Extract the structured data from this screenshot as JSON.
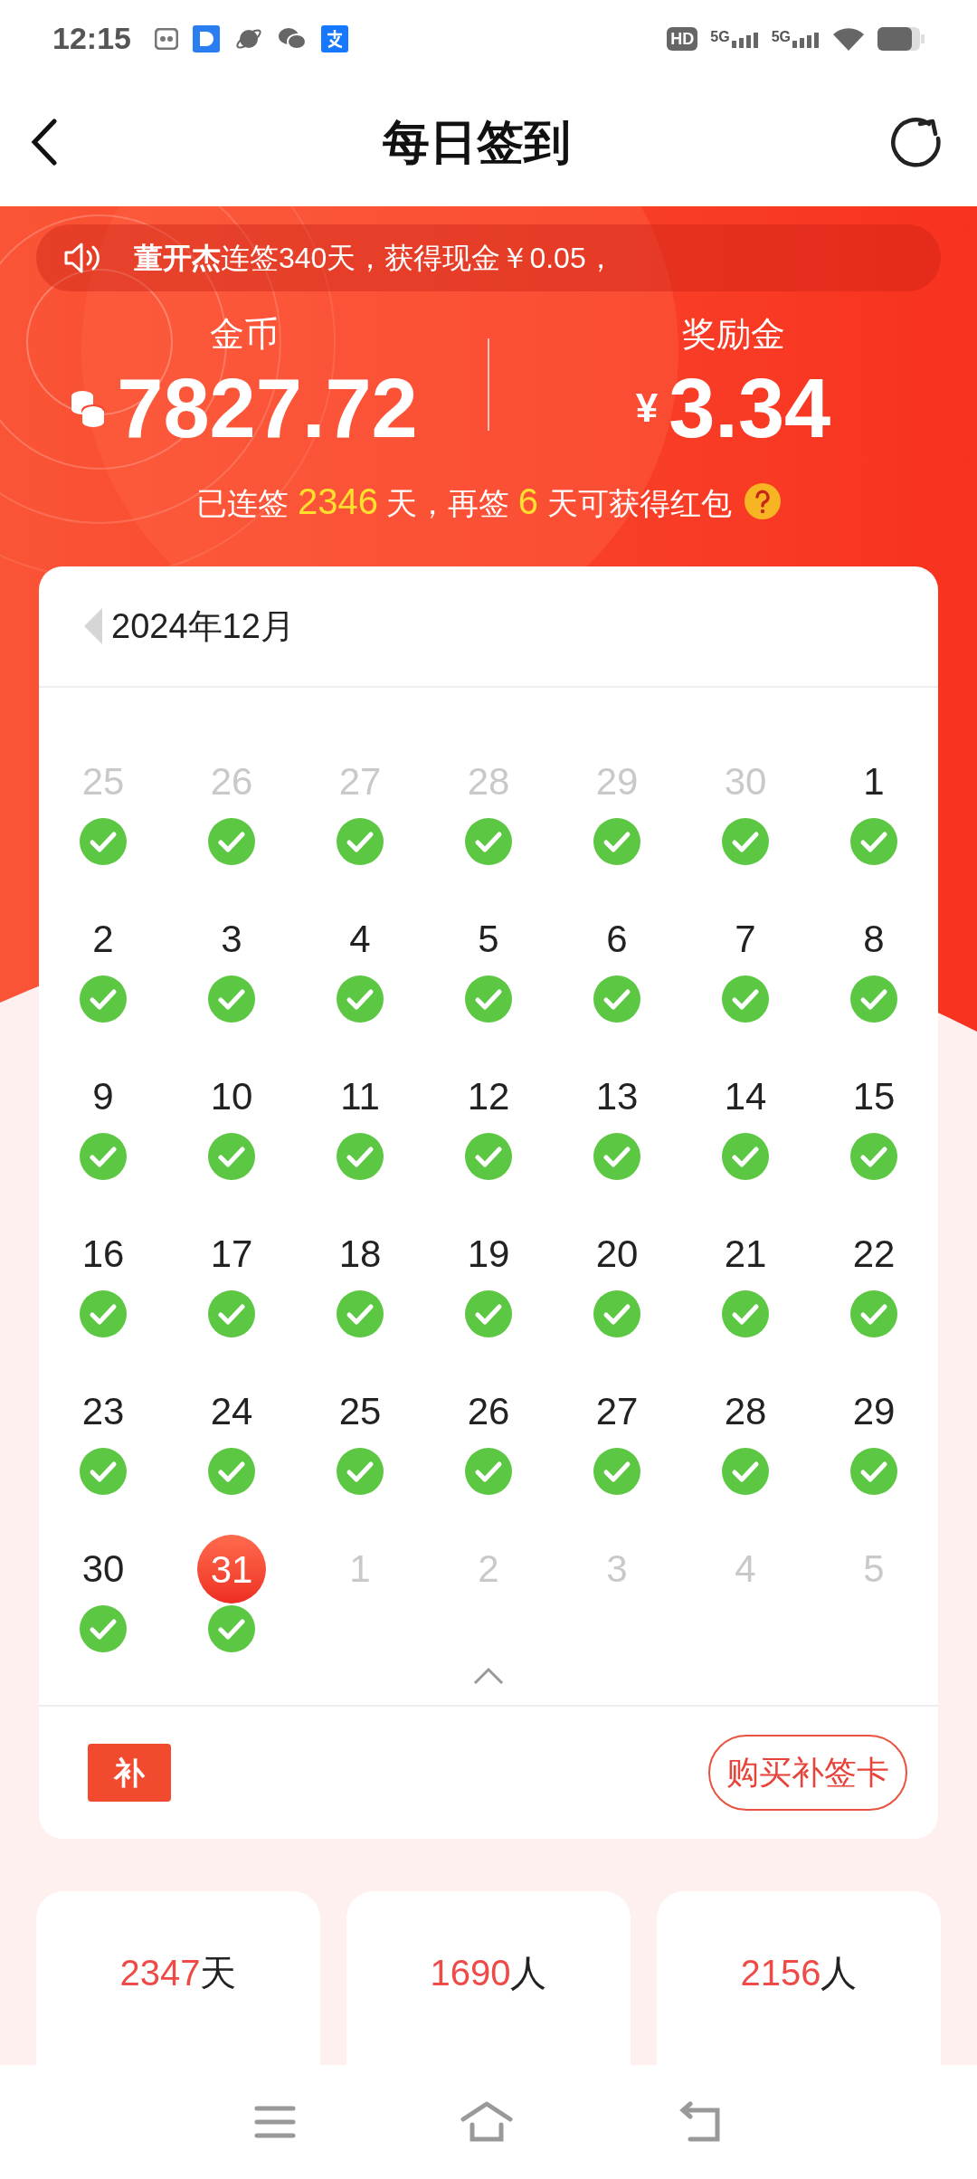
{
  "status_bar": {
    "time": "12:15",
    "hd_label": "HD",
    "network_labels": [
      "5G",
      "5G"
    ]
  },
  "header": {
    "title": "每日签到"
  },
  "ticker": {
    "text": "**董开杰**连签340天，获得现金￥0.05，"
  },
  "balances": [
    {
      "kind": "coins",
      "label": "金币",
      "value": "7827.72"
    },
    {
      "kind": "cash",
      "label": "奖励金",
      "currency": "¥",
      "value": "3.34"
    }
  ],
  "streak": {
    "prefix": "已连签 ",
    "days": "2346",
    "middle": " 天，再签 ",
    "remaining": "6",
    "suffix": " 天可获得红包"
  },
  "calendar": {
    "month": "2024年12月",
    "days": [
      {
        "day": "25",
        "kind": "other_month",
        "signed": true,
        "selected": false
      },
      {
        "day": "26",
        "kind": "other_month",
        "signed": true,
        "selected": false
      },
      {
        "day": "27",
        "kind": "other_month",
        "signed": true,
        "selected": false
      },
      {
        "day": "28",
        "kind": "other_month",
        "signed": true,
        "selected": false
      },
      {
        "day": "29",
        "kind": "other_month",
        "signed": true,
        "selected": false
      },
      {
        "day": "30",
        "kind": "other_month",
        "signed": true,
        "selected": false
      },
      {
        "day": "1",
        "kind": "current",
        "signed": true,
        "selected": false
      },
      {
        "day": "2",
        "kind": "current",
        "signed": true,
        "selected": false
      },
      {
        "day": "3",
        "kind": "current",
        "signed": true,
        "selected": false
      },
      {
        "day": "4",
        "kind": "current",
        "signed": true,
        "selected": false
      },
      {
        "day": "5",
        "kind": "current",
        "signed": true,
        "selected": false
      },
      {
        "day": "6",
        "kind": "current",
        "signed": true,
        "selected": false
      },
      {
        "day": "7",
        "kind": "current",
        "signed": true,
        "selected": false
      },
      {
        "day": "8",
        "kind": "current",
        "signed": true,
        "selected": false
      },
      {
        "day": "9",
        "kind": "current",
        "signed": true,
        "selected": false
      },
      {
        "day": "10",
        "kind": "current",
        "signed": true,
        "selected": false
      },
      {
        "day": "11",
        "kind": "current",
        "signed": true,
        "selected": false
      },
      {
        "day": "12",
        "kind": "current",
        "signed": true,
        "selected": false
      },
      {
        "day": "13",
        "kind": "current",
        "signed": true,
        "selected": false
      },
      {
        "day": "14",
        "kind": "current",
        "signed": true,
        "selected": false
      },
      {
        "day": "15",
        "kind": "current",
        "signed": true,
        "selected": false
      },
      {
        "day": "16",
        "kind": "current",
        "signed": true,
        "selected": false
      },
      {
        "day": "17",
        "kind": "current",
        "signed": true,
        "selected": false
      },
      {
        "day": "18",
        "kind": "current",
        "signed": true,
        "selected": false
      },
      {
        "day": "19",
        "kind": "current",
        "signed": true,
        "selected": false
      },
      {
        "day": "20",
        "kind": "current",
        "signed": true,
        "selected": false
      },
      {
        "day": "21",
        "kind": "current",
        "signed": true,
        "selected": false
      },
      {
        "day": "22",
        "kind": "current",
        "signed": true,
        "selected": false
      },
      {
        "day": "23",
        "kind": "current",
        "signed": true,
        "selected": false
      },
      {
        "day": "24",
        "kind": "current",
        "signed": true,
        "selected": false
      },
      {
        "day": "25",
        "kind": "current",
        "signed": true,
        "selected": false
      },
      {
        "day": "26",
        "kind": "current",
        "signed": true,
        "selected": false
      },
      {
        "day": "27",
        "kind": "current",
        "signed": true,
        "selected": false
      },
      {
        "day": "28",
        "kind": "current",
        "signed": true,
        "selected": false
      },
      {
        "day": "29",
        "kind": "current",
        "signed": true,
        "selected": false
      },
      {
        "day": "30",
        "kind": "current",
        "signed": true,
        "selected": false
      },
      {
        "day": "31",
        "kind": "current",
        "signed": true,
        "selected": true
      },
      {
        "day": "1",
        "kind": "other_month",
        "signed": false,
        "selected": false
      },
      {
        "day": "2",
        "kind": "other_month",
        "signed": false,
        "selected": false
      },
      {
        "day": "3",
        "kind": "other_month",
        "signed": false,
        "selected": false
      },
      {
        "day": "4",
        "kind": "other_month",
        "signed": false,
        "selected": false
      },
      {
        "day": "5",
        "kind": "other_month",
        "signed": false,
        "selected": false
      }
    ]
  },
  "makeup_card": {
    "ticket_label": "补",
    "button": "购买补签卡"
  },
  "stats": [
    {
      "value": "2347",
      "unit": "天"
    },
    {
      "value": "1690",
      "unit": "人"
    },
    {
      "value": "2156",
      "unit": "人"
    }
  ]
}
